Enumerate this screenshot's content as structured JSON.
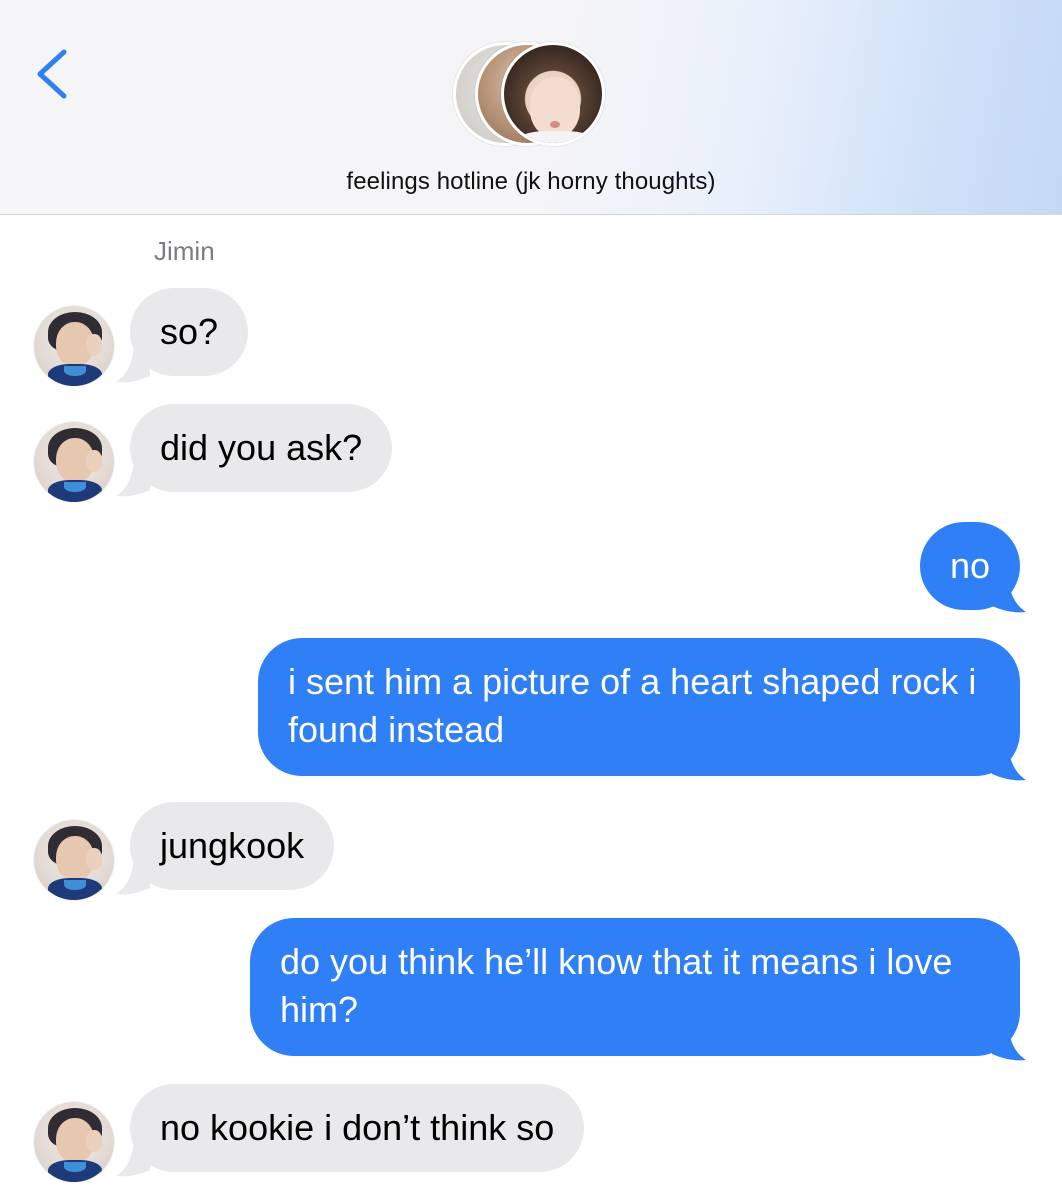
{
  "header": {
    "back_label": "",
    "group_title": "feelings hotline (jk horny thoughts)",
    "avatars": [
      "group-member-avatar-1",
      "group-member-avatar-2",
      "group-member-avatar-3"
    ]
  },
  "conversation": {
    "sender_name": "Jimin",
    "messages": [
      {
        "direction": "incoming",
        "text": "so?"
      },
      {
        "direction": "incoming",
        "text": "did you ask?"
      },
      {
        "direction": "outgoing",
        "text": "no"
      },
      {
        "direction": "outgoing",
        "text": "i sent him a picture of a heart shaped rock i found instead"
      },
      {
        "direction": "incoming",
        "text": "jungkook"
      },
      {
        "direction": "outgoing",
        "text": "do you think he’ll know that it means i love him?"
      },
      {
        "direction": "incoming",
        "text": "no kookie i don’t think so"
      }
    ]
  },
  "colors": {
    "incoming_bubble": "#e9e9eb",
    "outgoing_bubble": "#2f7ff6",
    "accent": "#2f7ff6"
  }
}
